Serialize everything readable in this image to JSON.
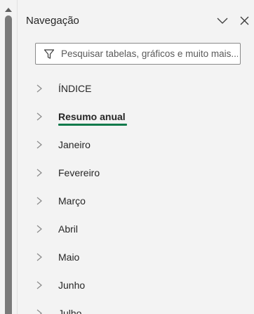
{
  "pane": {
    "title": "Navegação",
    "collapse_icon": "chevron-down-icon",
    "close_icon": "close-icon"
  },
  "search": {
    "placeholder": "Pesquisar tabelas, gráficos e muito mais...",
    "value": "",
    "icon": "filter-icon"
  },
  "tree": {
    "items": [
      {
        "label": "ÍNDICE",
        "active": false
      },
      {
        "label": "Resumo anual",
        "active": true
      },
      {
        "label": "Janeiro",
        "active": false
      },
      {
        "label": "Fevereiro",
        "active": false
      },
      {
        "label": "Março",
        "active": false
      },
      {
        "label": "Abril",
        "active": false
      },
      {
        "label": "Maio",
        "active": false
      },
      {
        "label": "Junho",
        "active": false
      },
      {
        "label": "Julho",
        "active": false
      }
    ]
  },
  "colors": {
    "accent": "#117a4c",
    "background": "#f3f3f3",
    "text": "#262626"
  }
}
